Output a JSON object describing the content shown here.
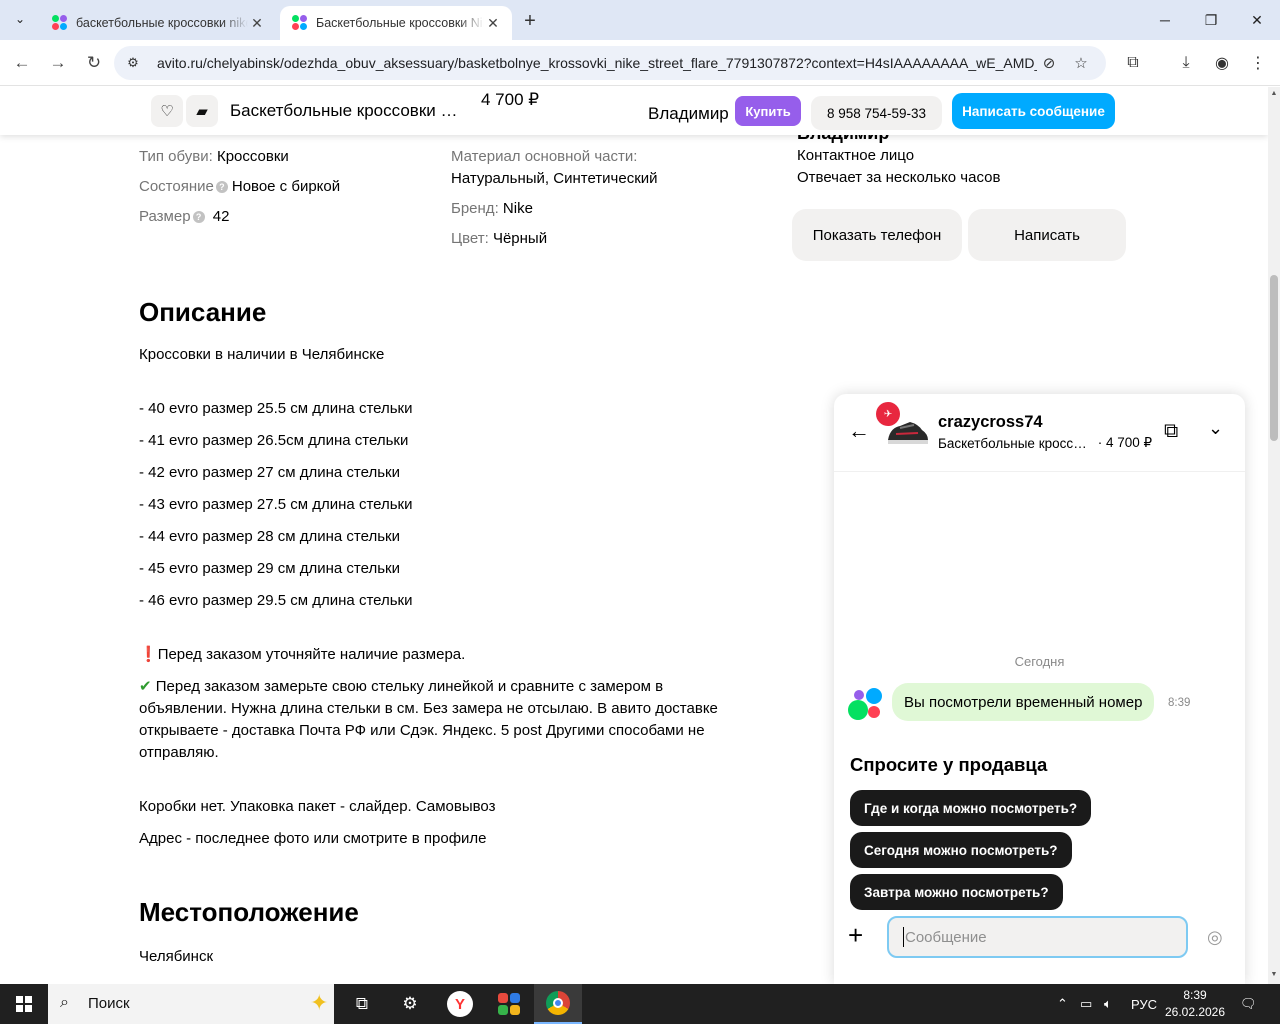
{
  "browser": {
    "tabs": [
      {
        "title": "баскетбольные кроссовки nike street",
        "active": false
      },
      {
        "title": "Баскетбольные кроссовки Nike Street",
        "active": true
      }
    ],
    "url": "avito.ru/chelyabinsk/odezhda_obuv_aksessuary/basketbolnye_krossovki_nike_street_flare_7791307872?context=H4sIAAAAAAAA_wE_AMD_..."
  },
  "sticky_header": {
    "title": "Баскетбольные кроссовки Nike Street Flare",
    "price": "4 700 ₽",
    "seller": "Владимир",
    "buy_label": "Купить",
    "phone": "8 958 754-59-33",
    "message_label": "Написать сообщение"
  },
  "params_left": [
    {
      "key": "Тип обуви:",
      "value": "Кроссовки",
      "help": false
    },
    {
      "key": "Состояние",
      "value": "Новое с биркой",
      "help": true
    },
    {
      "key": "Размер",
      "value": "42",
      "help": true
    }
  ],
  "params_right": {
    "material_key": "Материал основной части:",
    "material_value": "Натуральный, Синтетический",
    "brand_key": "Бренд:",
    "brand_value": "Nike",
    "color_key": "Цвет:",
    "color_value": "Чёрный"
  },
  "seller_card": {
    "name": "Владимир",
    "role": "Контактное лицо",
    "response": "Отвечает за несколько часов",
    "show_phone_label": "Показать телефон",
    "write_label": "Написать"
  },
  "description": {
    "heading": "Описание",
    "intro": "Кроссовки в наличии в Челябинске",
    "sizes": [
      "- 40 evro размер 25.5 см длина стельки",
      "- 41 evro размер 26.5см длина стельки",
      "- 42 evro размер 27 см длина стельки",
      "- 43 evro размер 27.5 см длина стельки",
      "- 44 evro размер 28 см длина стельки",
      "- 45 evro размер 29 см длина стельки",
      "- 46 evro размер 29.5 см длина стельки"
    ],
    "warning": "Перед заказом уточняйте наличие размера.",
    "note": "Перед заказом замерьте свою стельку линейкой и сравните с замером в объявлении. Нужна длина стельки в см. Без замера не отсылаю. В авито доставке открываете - доставка Почта РФ или Сдэк. Яндекс. 5 post Другими способами не отправляю.",
    "box": "Коробки нет. Упаковка пакет - слайдер. Самовывоз",
    "address": "Адрес - последнее фото или смотрите в профиле"
  },
  "location": {
    "heading": "Местоположение",
    "city": "Челябинск"
  },
  "chat": {
    "username": "crazycross74",
    "item_title": "Баскетбольные кроссовки Nike Street Flare",
    "item_price": "· 4 700 ₽",
    "date_label": "Сегодня",
    "message": "Вы посмотрели временный номер",
    "message_time": "8:39",
    "ask_title": "Спросите у продавца",
    "chips": [
      "Где и когда можно посмотреть?",
      "Сегодня можно посмотреть?",
      "Завтра можно посмотреть?"
    ],
    "input_placeholder": "Сообщение"
  },
  "taskbar": {
    "search_label": "Поиск",
    "lang": "РУС",
    "time": "8:39",
    "date": "26.02.2026"
  },
  "colors": {
    "avito_blue": "#00aaff",
    "buy_purple": "#965eeb",
    "bubble_green": "#e0f8d6"
  }
}
